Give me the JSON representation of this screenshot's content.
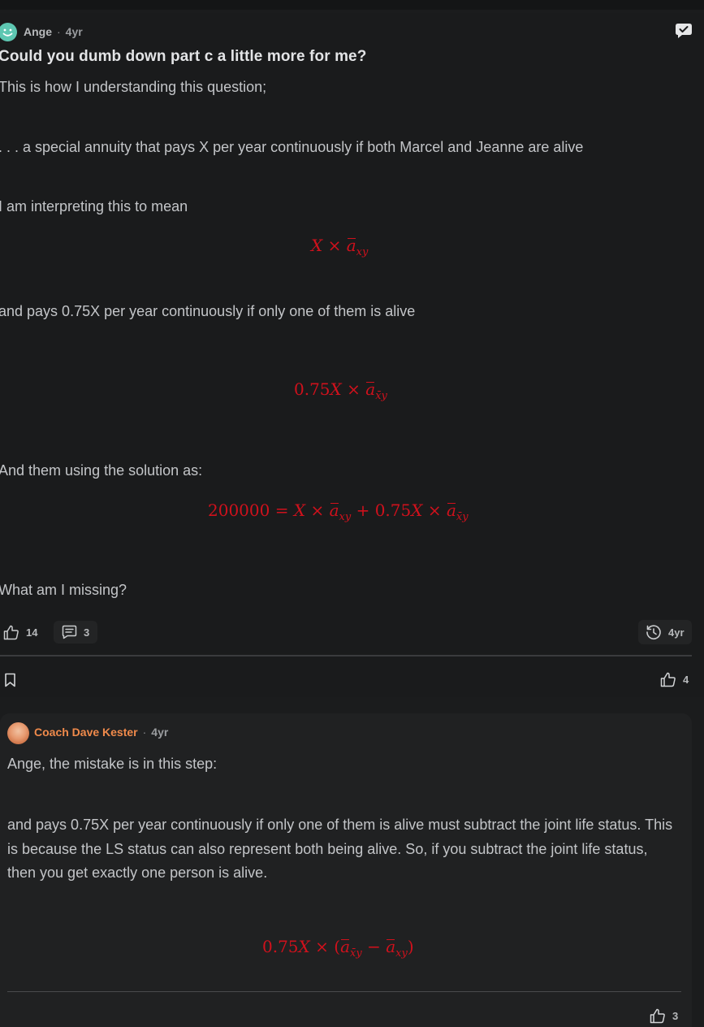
{
  "post": {
    "author": "Ange",
    "separator": "·",
    "time": "4yr",
    "title": "Could you dumb down part c a little more for me?",
    "p1": "This is how I understanding this question;",
    "p2": ". . . a special annuity that pays X per year continuously if both Marcel and Jeanne are alive",
    "p3": "I am interpreting this to mean",
    "p4": "and pays 0.75X per year continuously if only one of them is alive",
    "p5": "And them using the solution as:",
    "p6": "What am I missing?",
    "math1": {
      "a": "X",
      "op": "×",
      "sub": "xy"
    },
    "math2": {
      "coef": "0.75",
      "a": "X",
      "op": "×",
      "sub": "x̄y"
    },
    "math3": {
      "lhs": "200000",
      "eq": "=",
      "a": "X",
      "op": "×",
      "sub1": "xy",
      "plus": "+",
      "coef": "0.75",
      "b": "X",
      "op2": "×",
      "sub2": "x̄y"
    },
    "likes": "14",
    "comments": "3",
    "history_time": "4yr",
    "bookmark_likes": "4"
  },
  "reply": {
    "author": "Coach Dave Kester",
    "separator": "·",
    "time": "4yr",
    "p1": "Ange, the mistake is in this step:",
    "p2": "and pays 0.75X per year continuously if only one of them is alive must subtract the joint life status. This is because the LS status can also represent both being alive. So, if you subtract the joint life status, then you get exactly one person is alive.",
    "math": {
      "coef": "0.75",
      "a": "X",
      "op": "×",
      "lp": "(",
      "sub1": "x̄y",
      "minus": "−",
      "sub2": "xy",
      "rp": ")"
    },
    "likes": "3"
  },
  "colors": {
    "accent_red": "#d0111c",
    "coach_orange": "#f08a4b",
    "avatar_teal": "#5ec7b2"
  }
}
